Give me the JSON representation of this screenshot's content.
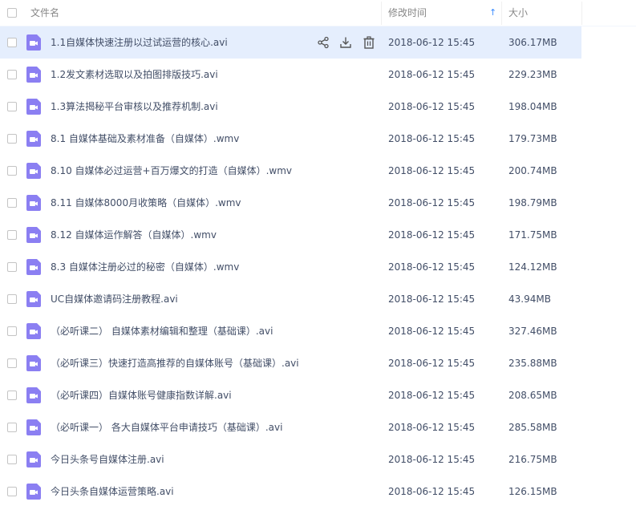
{
  "header": {
    "name_label": "文件名",
    "modified_label": "修改时间",
    "size_label": "大小",
    "sort_arrow": "↑"
  },
  "files": [
    {
      "name": "1.1自媒体快速注册以过试运营的核心.avi",
      "modified": "2018-06-12 15:45",
      "size": "306.17MB"
    },
    {
      "name": "1.2发文素材选取以及拍图排版技巧.avi",
      "modified": "2018-06-12 15:45",
      "size": "229.23MB"
    },
    {
      "name": "1.3算法揭秘平台审核以及推荐机制.avi",
      "modified": "2018-06-12 15:45",
      "size": "198.04MB"
    },
    {
      "name": "8.1 自媒体基础及素材准备（自媒体）.wmv",
      "modified": "2018-06-12 15:45",
      "size": "179.73MB"
    },
    {
      "name": "8.10 自媒体必过运营+百万爆文的打造（自媒体）.wmv",
      "modified": "2018-06-12 15:45",
      "size": "200.74MB"
    },
    {
      "name": "8.11 自媒体8000月收策略（自媒体）.wmv",
      "modified": "2018-06-12 15:45",
      "size": "198.79MB"
    },
    {
      "name": "8.12 自媒体运作解答（自媒体）.wmv",
      "modified": "2018-06-12 15:45",
      "size": "171.75MB"
    },
    {
      "name": "8.3 自媒体注册必过的秘密（自媒体）.wmv",
      "modified": "2018-06-12 15:45",
      "size": "124.12MB"
    },
    {
      "name": "UC自媒体邀请码注册教程.avi",
      "modified": "2018-06-12 15:45",
      "size": "43.94MB"
    },
    {
      "name": "（必听课二） 自媒体素材编辑和整理（基础课）.avi",
      "modified": "2018-06-12 15:45",
      "size": "327.46MB"
    },
    {
      "name": "（必听课三）快速打造高推荐的自媒体账号（基础课）.avi",
      "modified": "2018-06-12 15:45",
      "size": "235.88MB"
    },
    {
      "name": "（必听课四）自媒体账号健康指数详解.avi",
      "modified": "2018-06-12 15:45",
      "size": "208.65MB"
    },
    {
      "name": "（必听课一） 各大自媒体平台申请技巧（基础课）.avi",
      "modified": "2018-06-12 15:45",
      "size": "285.58MB"
    },
    {
      "name": "今日头条号自媒体注册.avi",
      "modified": "2018-06-12 15:45",
      "size": "216.75MB"
    },
    {
      "name": "今日头条自媒体运营策略.avi",
      "modified": "2018-06-12 15:45",
      "size": "126.15MB"
    }
  ],
  "row_actions": [
    "share-icon",
    "download-icon",
    "delete-icon"
  ],
  "colors": {
    "accent": "#3b8cff",
    "file_icon": "#8b7ff2",
    "hover_row": "#e5eefd",
    "text": "#424e67"
  }
}
